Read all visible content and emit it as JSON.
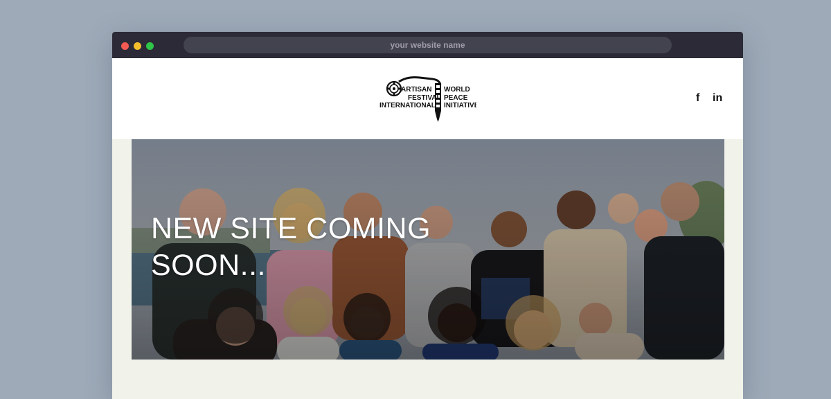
{
  "browser": {
    "url_text": "your website name"
  },
  "header": {
    "logo": {
      "text_lines_left": [
        "ARTISAN",
        "FESTIVAL",
        "INTERNATIONAL"
      ],
      "text_lines_right": [
        "WORLD",
        "PEACE",
        "INITIATIVE"
      ]
    },
    "social": {
      "facebook_glyph": "f",
      "linkedin_glyph": "in"
    }
  },
  "hero": {
    "title": "NEW SITE COMING SOON..."
  },
  "colors": {
    "page_background": "#9eaab8",
    "titlebar": "#2b2a36",
    "content_background": "#f1f2ea",
    "header_background": "#ffffff",
    "hero_text": "#ffffff"
  },
  "icons": [
    "close-dot-icon",
    "minimize-dot-icon",
    "maximize-dot-icon",
    "facebook-icon",
    "linkedin-icon"
  ]
}
